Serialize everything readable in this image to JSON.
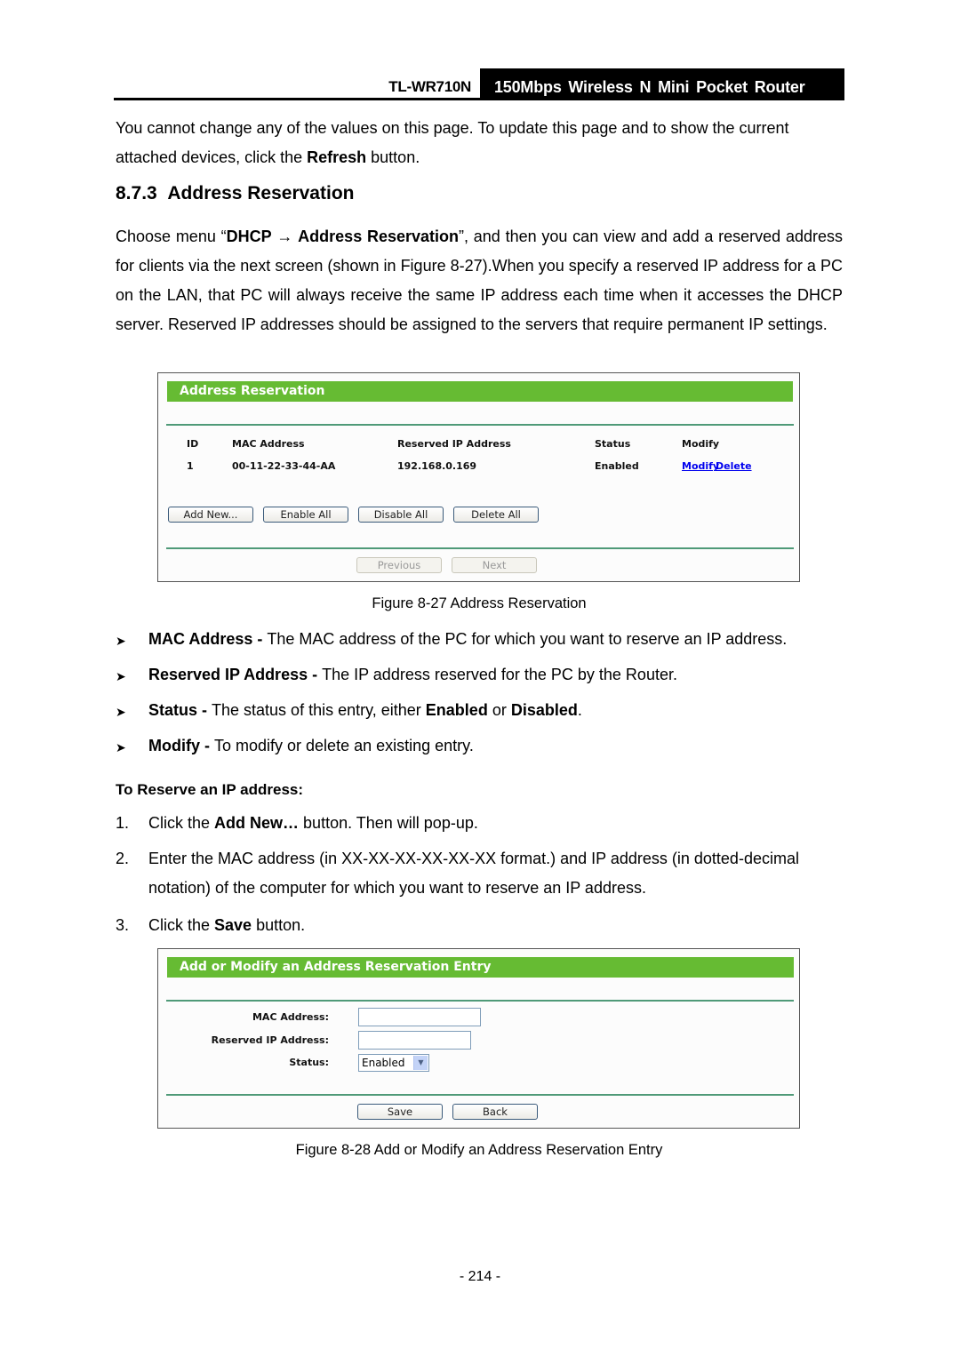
{
  "header": {
    "model": "TL-WR710N",
    "product": "150Mbps Wireless N Mini Pocket Router"
  },
  "intro": {
    "text_before": "You cannot change any of the values on this page. To update this page and to show the current attached devices, click the ",
    "bold": "Refresh",
    "text_after": " button."
  },
  "section": {
    "number": "8.7.3",
    "title": "Address Reservation"
  },
  "description": {
    "part1": "Choose menu “",
    "menu_bold_1": "DHCP",
    "arrow": " → ",
    "menu_bold_2": "Address Reservation",
    "part2": "”, and then you can view and add a reserved address for clients via the next screen (shown in Figure 8-27).When you specify a reserved IP address for a PC on the LAN, that PC will always receive the same IP address each time when it accesses the DHCP server. Reserved IP addresses should be assigned to the servers that require permanent IP settings."
  },
  "figure1": {
    "title": "Address Reservation",
    "columns": [
      "ID",
      "MAC Address",
      "Reserved IP Address",
      "Status",
      "Modify"
    ],
    "rows": [
      {
        "id": "1",
        "mac": "00-11-22-33-44-AA",
        "ip": "192.168.0.169",
        "status": "Enabled",
        "modify_link": "Modify",
        "delete_link": "Delete"
      }
    ],
    "buttons": {
      "add_new": "Add New...",
      "enable_all": "Enable All",
      "disable_all": "Disable All",
      "delete_all": "Delete All",
      "previous": "Previous",
      "next": "Next"
    },
    "caption": "Figure 8-27 Address Reservation"
  },
  "definitions": [
    {
      "term": "MAC Address - ",
      "text": "The MAC address of the PC for which you want to reserve an IP address."
    },
    {
      "term": "Reserved IP Address - ",
      "text": "The IP address reserved for the PC by the Router."
    },
    {
      "term": "Status - ",
      "text": "The status of this entry, either ",
      "bold2": "Enabled",
      "mid": " or ",
      "bold3": "Disabled",
      "end": "."
    },
    {
      "term": "Modify - ",
      "text": "To modify or delete an existing entry."
    }
  ],
  "procedure": {
    "heading": "To Reserve an IP address:",
    "steps": [
      {
        "num": "1.",
        "pre": "Click the ",
        "bold": "Add New…",
        "post": " button. Then will pop-up."
      },
      {
        "num": "2.",
        "line1": "Enter the MAC address (in XX-XX-XX-XX-XX-XX format.) and IP address (in dotted-decimal",
        "line2": "notation) of the computer for which you want to reserve an IP address."
      },
      {
        "num": "3.",
        "pre": "Click the ",
        "bold": "Save",
        "post": " button."
      }
    ]
  },
  "figure2": {
    "title": "Add or Modify an Address Reservation Entry",
    "fields": {
      "mac_label": "MAC Address:",
      "mac_value": "",
      "ip_label": "Reserved IP Address:",
      "ip_value": "",
      "status_label": "Status:",
      "status_selected": "Enabled"
    },
    "buttons": {
      "save": "Save",
      "back": "Back"
    },
    "caption": "Figure 8-28 Add or Modify an Address Reservation Entry"
  },
  "page_number": "- 214 -"
}
